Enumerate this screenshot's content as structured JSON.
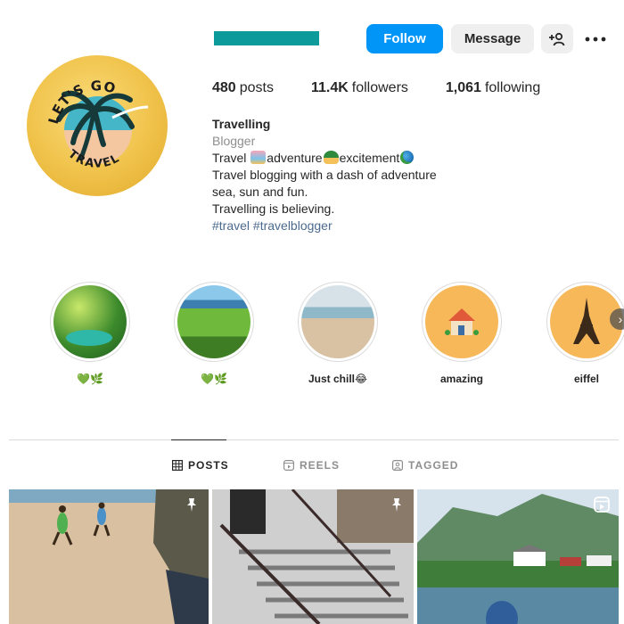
{
  "header": {
    "follow_label": "Follow",
    "message_label": "Message",
    "accent_color": "#0095f6",
    "username_redaction_color": "#0d9a9a"
  },
  "avatar": {
    "text_top": "LET'S GO",
    "text_bottom": "TRAVEL"
  },
  "stats": {
    "posts_count": "480",
    "posts_label": "posts",
    "followers_count": "11.4K",
    "followers_label": "followers",
    "following_count": "1,061",
    "following_label": "following"
  },
  "bio": {
    "name": "Travelling",
    "category": "Blogger",
    "line1_part1": "Travel ",
    "line1_part2": "adventure",
    "line1_part3": "excitement",
    "line2": "Travel blogging with a dash of adventure",
    "line3": "sea, sun and fun.",
    "line4": "Travelling is believing.",
    "hashtags": "#travel #travelblogger"
  },
  "highlights": [
    {
      "label": "💚🌿"
    },
    {
      "label": "💚🌿"
    },
    {
      "label": "Just chill😂"
    },
    {
      "label": "amazing"
    },
    {
      "label": "eiffel"
    }
  ],
  "tabs": {
    "posts": "POSTS",
    "reels": "REELS",
    "tagged": "TAGGED"
  },
  "posts": [
    {
      "icon": "pin-icon"
    },
    {
      "icon": "pin-icon"
    },
    {
      "icon": "reel-icon"
    }
  ]
}
